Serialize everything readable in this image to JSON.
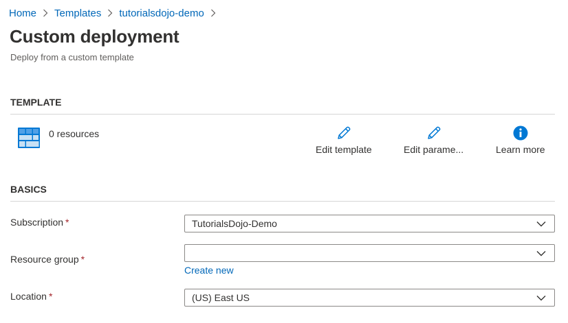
{
  "breadcrumb": {
    "items": [
      "Home",
      "Templates",
      "tutorialsdojo-demo"
    ]
  },
  "header": {
    "title": "Custom deployment",
    "subtitle": "Deploy from a custom template"
  },
  "template_section": {
    "heading": "TEMPLATE",
    "resources_label": "0 resources",
    "actions": [
      {
        "label": "Edit template",
        "icon": "pencil-icon"
      },
      {
        "label": "Edit parame...",
        "icon": "pencil-icon"
      },
      {
        "label": "Learn more",
        "icon": "info-icon"
      }
    ]
  },
  "basics_section": {
    "heading": "BASICS",
    "required_marker": "*",
    "subscription": {
      "label": "Subscription",
      "value": "TutorialsDojo-Demo"
    },
    "resource_group": {
      "label": "Resource group",
      "value": "",
      "create_new_label": "Create new"
    },
    "location": {
      "label": "Location",
      "value": "(US) East US"
    }
  },
  "colors": {
    "link": "#0067b8",
    "required": "#a4262c",
    "info": "#0078d4"
  }
}
